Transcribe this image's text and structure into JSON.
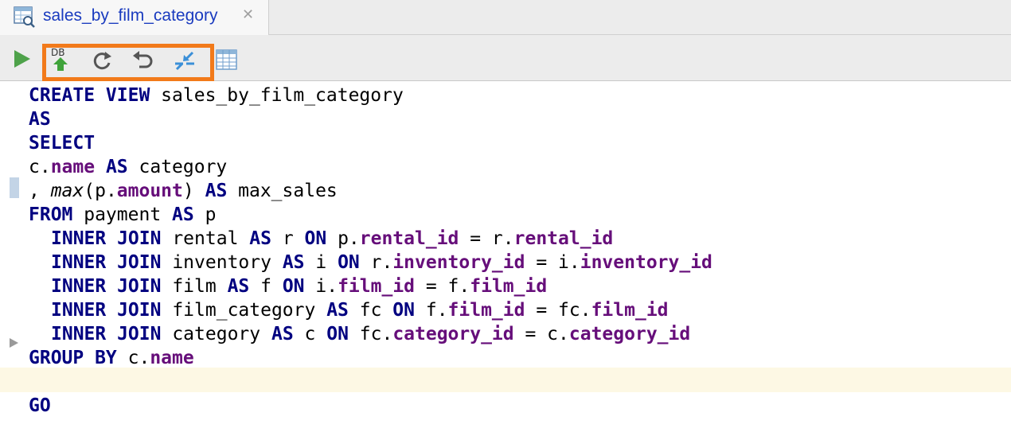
{
  "tab": {
    "title": "sales_by_film_category",
    "icon": "view-table-icon",
    "close": "✕"
  },
  "toolbar": {
    "buttons": [
      {
        "name": "run-icon",
        "label": ""
      },
      {
        "name": "submit-to-db-icon",
        "label": "DB"
      },
      {
        "name": "refresh-icon",
        "label": ""
      },
      {
        "name": "revert-icon",
        "label": ""
      },
      {
        "name": "compare-icon",
        "label": ""
      },
      {
        "name": "table-view-icon",
        "label": ""
      }
    ],
    "highlight_color": "#f27a1a"
  },
  "colors": {
    "keyword": "#000080",
    "field": "#660e7a",
    "tab_text": "#1a3bbf",
    "caret_line": "#fdf8e4"
  },
  "code": {
    "l1": {
      "t1": "CREATE VIEW",
      "t2": " sales_by_film_category"
    },
    "l2": {
      "t1": "AS"
    },
    "l3": {
      "t1": "SELECT"
    },
    "l4": {
      "t1": "c.",
      "t2": "name",
      "t3": " ",
      "t4": "AS",
      "t5": " category"
    },
    "l5": {
      "t1": ", ",
      "t2": "max",
      "t3": "(p.",
      "t4": "amount",
      "t5": ") ",
      "t6": "AS",
      "t7": " max_sales"
    },
    "l6": {
      "t1": "FROM",
      "t2": " payment ",
      "t3": "AS",
      "t4": " p"
    },
    "l7": {
      "t1": "INNER JOIN",
      "t2": " rental ",
      "t3": "AS",
      "t4": " r ",
      "t5": "ON",
      "t6": " p.",
      "t7": "rental_id",
      "t8": " = r.",
      "t9": "rental_id"
    },
    "l8": {
      "t1": "INNER JOIN",
      "t2": " inventory ",
      "t3": "AS",
      "t4": " i ",
      "t5": "ON",
      "t6": " r.",
      "t7": "inventory_id",
      "t8": " = i.",
      "t9": "inventory_id"
    },
    "l9": {
      "t1": "INNER JOIN",
      "t2": " film ",
      "t3": "AS",
      "t4": " f ",
      "t5": "ON",
      "t6": " i.",
      "t7": "film_id",
      "t8": " = f.",
      "t9": "film_id"
    },
    "l10": {
      "t1": "INNER JOIN",
      "t2": " film_category ",
      "t3": "AS",
      "t4": " fc ",
      "t5": "ON",
      "t6": " f.",
      "t7": "film_id",
      "t8": " = fc.",
      "t9": "film_id"
    },
    "l11": {
      "t1": "INNER JOIN",
      "t2": " category ",
      "t3": "AS",
      "t4": " c ",
      "t5": "ON",
      "t6": " fc.",
      "t7": "category_id",
      "t8": " = c.",
      "t9": "category_id"
    },
    "l12": {
      "t1": "GROUP BY",
      "t2": " c.",
      "t3": "name"
    },
    "l13": {
      "t1": ""
    },
    "l14": {
      "t1": "GO"
    }
  }
}
